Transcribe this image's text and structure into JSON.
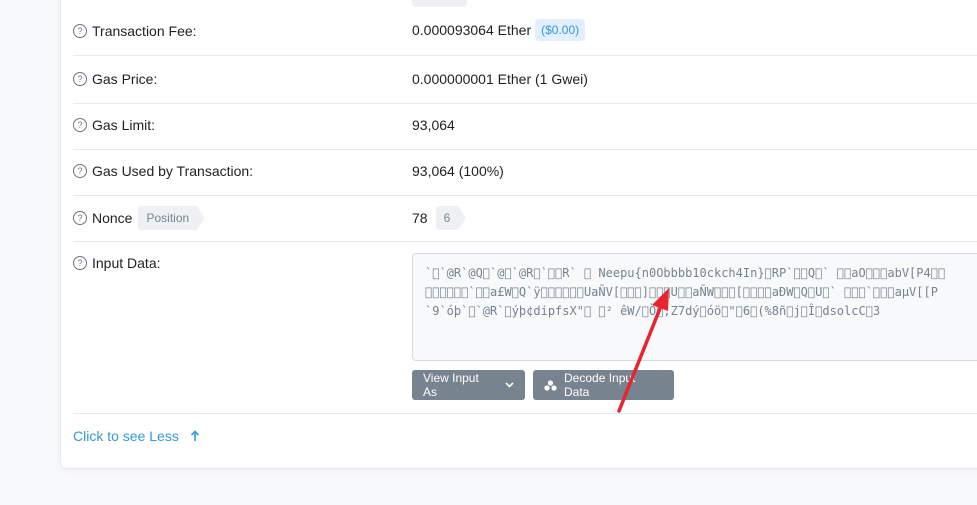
{
  "rows": {
    "fee": {
      "label": "Transaction Fee:",
      "value": "0.000093064 Ether",
      "usd": "($0.00)"
    },
    "gas_price": {
      "label": "Gas Price:",
      "value": "0.000000001 Ether (1 Gwei)"
    },
    "gas_limit": {
      "label": "Gas Limit:",
      "value": "93,064"
    },
    "gas_used": {
      "label": "Gas Used by Transaction:",
      "value": "93,064 (100%)"
    },
    "nonce": {
      "label": "Nonce",
      "badge": "Position",
      "value": "78",
      "position": "6"
    },
    "input": {
      "label": "Input Data:",
      "line1": "`\u0000`@R`@Q\u0000`@\u0000`@R\u0000`\u0000\u0000R` \u0000 Neepu{n0Obbbb10ckch4In}\u0000RP`\u0000\u0000Q\u0000` \u0000\u0000aO\u0000\u0000\u0000abV[P4\u0000\u0000",
      "line2": "\u0000\u0000\u0000\u0000\u0000\u0000`\u0000\u0000a£W\u0000Q`ÿ\u0000\u0000\u0000\u0000\u0000\u0000UaÑV[\u0000\u0000\u0000]\u0000\u0000\u0000U\u0000\u0000aÑW\u0000\u0000\u0000[\u0000\u0000\u0000\u0000aÐW\u0000Q\u0000U\u0000` \u0000\u0000\u0000`\u0000\u0000\u0000aµV[[P",
      "line3": "`9`óþ`\u0000`@R`\u0000ýþ¢dipfsX\"\u0000 \u0000² êW/\u0000Ö\u0000;Z7dý\u0000óö\u0000\"\u00006\u0000(%8ñ\u0000j\u0000Î\u0000dsolcC\u00003"
    }
  },
  "buttons": {
    "view_input": "View Input As",
    "decode": "Decode Input Data"
  },
  "link": {
    "see_less": "Click to see Less"
  },
  "colors": {
    "accent": "#3498db",
    "annotation_arrow": "#e8242e"
  }
}
